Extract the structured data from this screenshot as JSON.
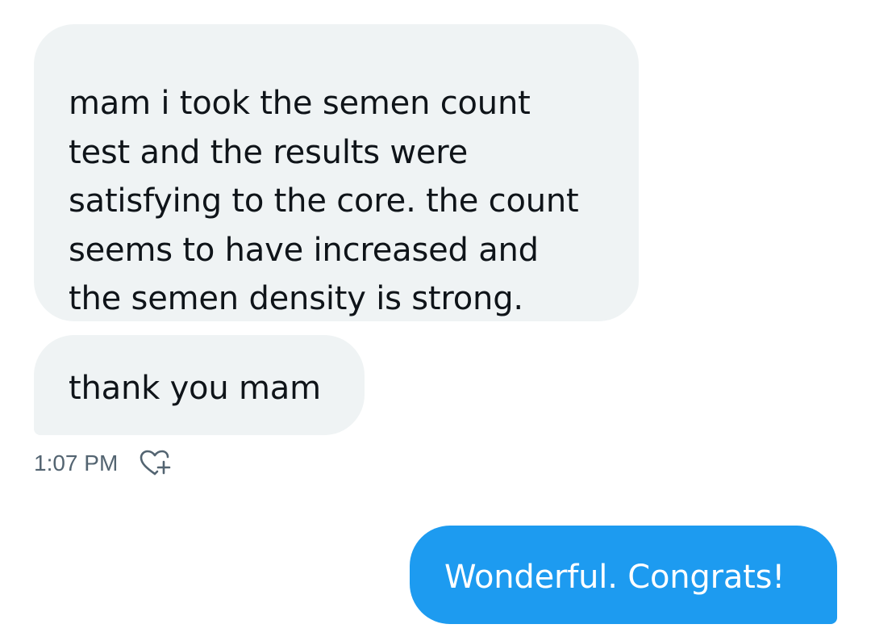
{
  "conversation": {
    "messages": [
      {
        "direction": "received",
        "lines": [
          "mam i took the semen count",
          "test and the results were",
          "satisfying to the core. the count",
          "seems to have increased and",
          "the semen density is strong."
        ]
      },
      {
        "direction": "received",
        "text": "thank you mam"
      },
      {
        "direction": "sent",
        "text": "Wonderful. Congrats!"
      }
    ],
    "received_timestamp": "1:07 PM",
    "reaction_icon": "heart-plus-icon"
  },
  "colors": {
    "received_bubble": "#eff3f4",
    "sent_bubble": "#1d9bf0",
    "timestamp_text": "#536471"
  }
}
